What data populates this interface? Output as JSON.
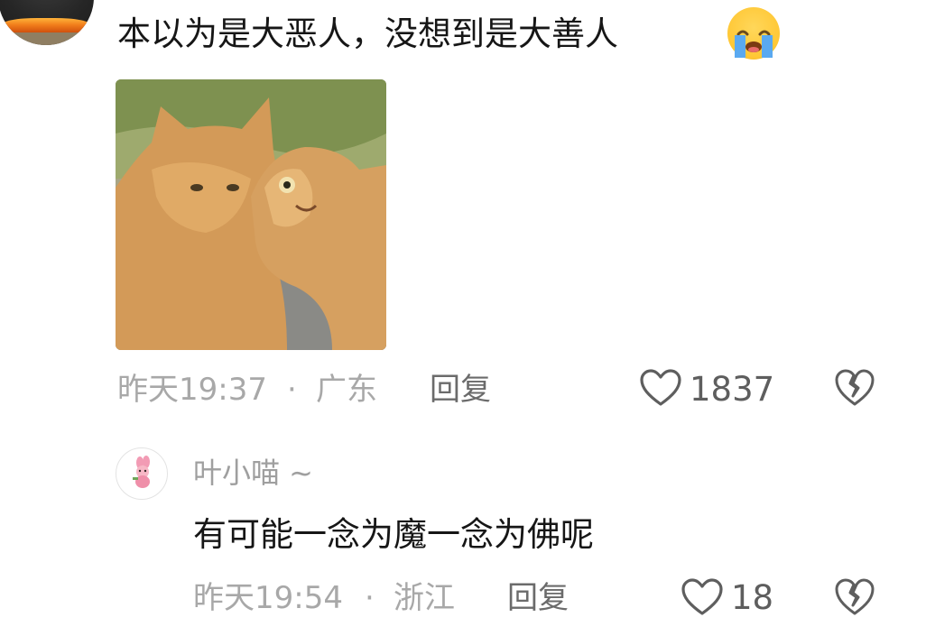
{
  "comment": {
    "text": "本以为是大恶人，没想到是大善人",
    "emoji": "loudly-crying-face",
    "time": "昨天19:37",
    "separator": "·",
    "location": "广东",
    "reply_label": "回复",
    "like_count": "1837"
  },
  "reply": {
    "username": "叶小喵 ~",
    "text": "有可能一念为魔一念为佛呢",
    "time": "昨天19:54",
    "separator": "·",
    "location": "浙江",
    "reply_label": "回复",
    "like_count": "18"
  },
  "colors": {
    "meta_gray": "#a8a8a8",
    "text_dark": "#161616",
    "icon_gray": "#5e5e5e"
  }
}
